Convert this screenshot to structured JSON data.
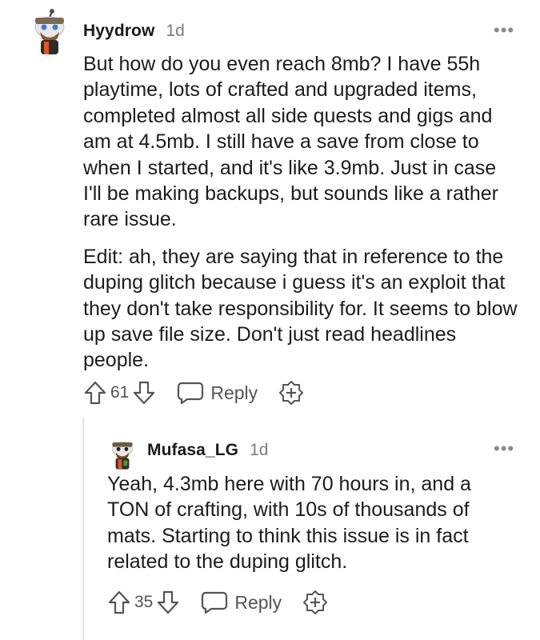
{
  "comments": [
    {
      "username": "Hyydrow",
      "age": "1d",
      "more": "•••",
      "paragraphs": [
        "But how do you even reach 8mb? I have 55h playtime, lots of crafted and upgraded items, completed almost all side quests and gigs and am at 4.5mb. I still have a save from close to when I started, and it's like 3.9mb. Just in case I'll be making backups, but sounds like a rather rare issue.",
        "Edit: ah, they are saying that in reference to the duping glitch because i guess it's an exploit that they don't take responsibility for. It seems to blow up save file size. Don't just read headlines people."
      ],
      "score": "61",
      "reply_label": "Reply"
    },
    {
      "username": "Mufasa_LG",
      "age": "1d",
      "more": "•••",
      "paragraphs": [
        "Yeah, 4.3mb here with 70 hours in, and a TON of crafting, with 10s of thousands of mats. Starting to think this issue is in fact related to the duping glitch."
      ],
      "score": "35",
      "reply_label": "Reply"
    }
  ],
  "icons": {
    "upvote": "upvote-arrow-icon",
    "downvote": "downvote-arrow-icon",
    "reply": "speech-bubble-icon",
    "award": "award-plus-icon",
    "more": "more-options-icon"
  }
}
